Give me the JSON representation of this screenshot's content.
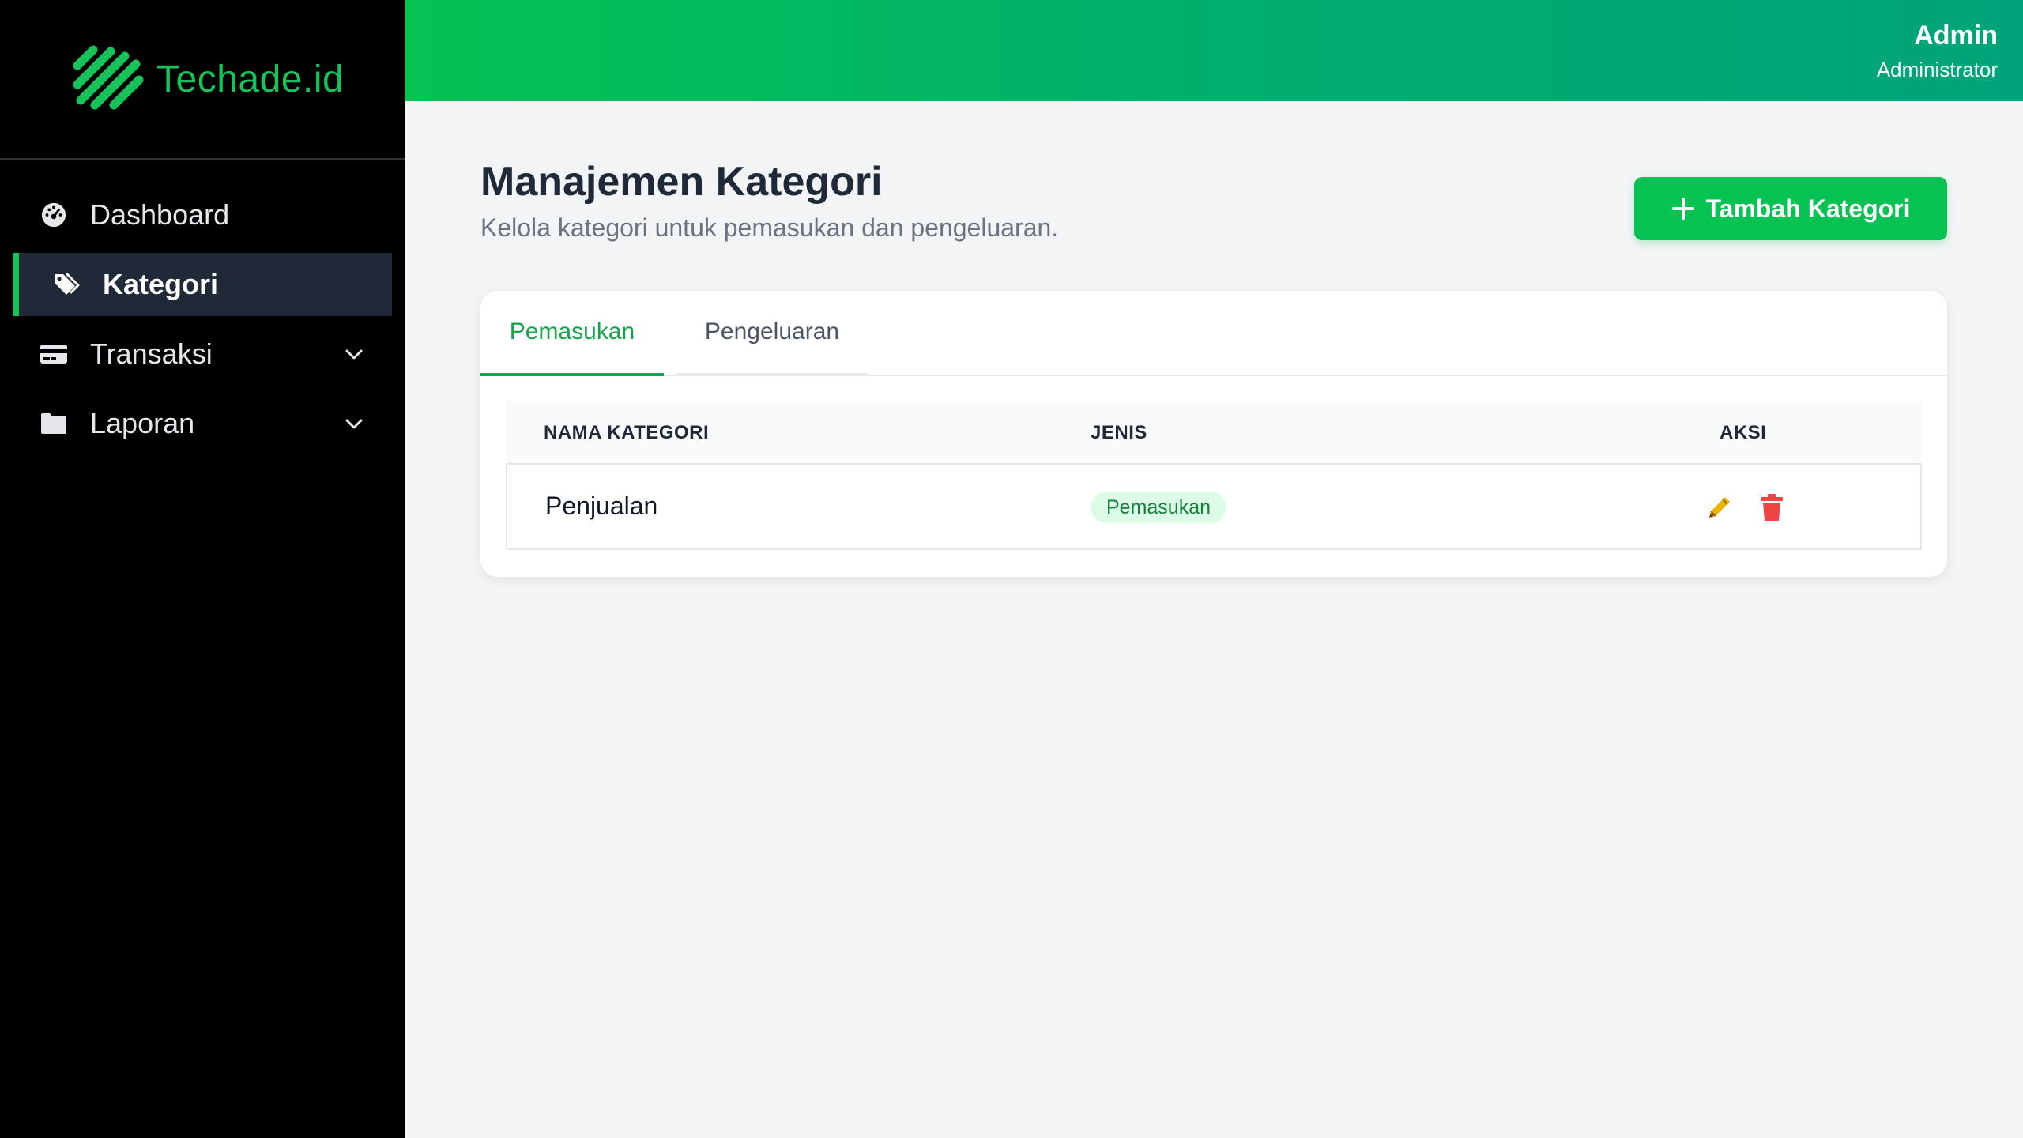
{
  "brand": {
    "name": "Techade.id"
  },
  "sidebar": {
    "items": [
      {
        "label": "Dashboard",
        "icon": "gauge-icon"
      },
      {
        "label": "Kategori",
        "icon": "tags-icon",
        "active": true
      },
      {
        "label": "Transaksi",
        "icon": "credit-card-icon",
        "expandable": true
      },
      {
        "label": "Laporan",
        "icon": "folder-icon",
        "expandable": true
      }
    ]
  },
  "header": {
    "user_name": "Admin",
    "user_role": "Administrator"
  },
  "page": {
    "title": "Manajemen Kategori",
    "subtitle": "Kelola kategori untuk pemasukan dan pengeluaran.",
    "add_button": "Tambah Kategori"
  },
  "tabs": [
    {
      "label": "Pemasukan",
      "active": true
    },
    {
      "label": "Pengeluaran",
      "active": false
    }
  ],
  "table": {
    "headers": [
      "NAMA KATEGORI",
      "JENIS",
      "AKSI"
    ],
    "rows": [
      {
        "name": "Penjualan",
        "jenis": "Pemasukan"
      }
    ]
  },
  "colors": {
    "accent": "#16c25a",
    "header_gradient_start": "#05c253",
    "header_gradient_end": "#00a37a",
    "edit": "#eab308",
    "delete": "#ef4444"
  }
}
